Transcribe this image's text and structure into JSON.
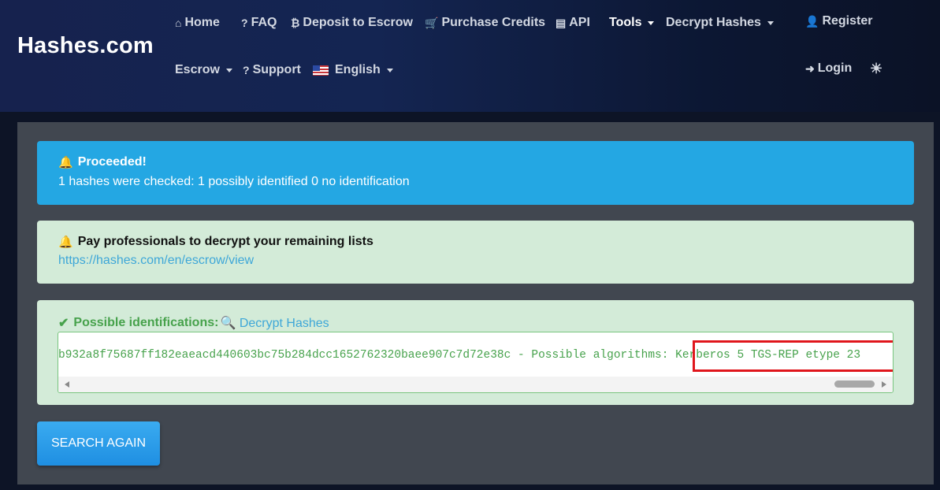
{
  "brand": "Hashes.com",
  "nav": {
    "home": "Home",
    "faq": "FAQ",
    "deposit": "Deposit to Escrow",
    "purchase": "Purchase Credits",
    "api": "API",
    "tools": "Tools",
    "decrypt": "Decrypt Hashes",
    "escrow": "Escrow",
    "support": "Support",
    "language": "English",
    "register": "Register",
    "login": "Login"
  },
  "alerts": {
    "info": {
      "title": "Proceeded!",
      "text": "1 hashes were checked: 1 possibly identified 0 no identification"
    },
    "promo": {
      "title": "Pay professionals to decrypt your remaining lists",
      "link": "https://hashes.com/en/escrow/view"
    },
    "result": {
      "title": "Possible identifications:",
      "link": "Decrypt Hashes",
      "hash": "b932a8f75687ff182eaeacd440603bc75b284dcc1652762320baee907c7d72e38c",
      "separator": " - Possible algorithms: ",
      "algorithm": "Kerberos 5 TGS-REP etype 23"
    }
  },
  "search_again": "SEARCH AGAIN",
  "colors": {
    "info": "#24a7e3",
    "success_bg": "#d3ebd8",
    "success_text": "#47a24c",
    "highlight": "#e0161c"
  }
}
